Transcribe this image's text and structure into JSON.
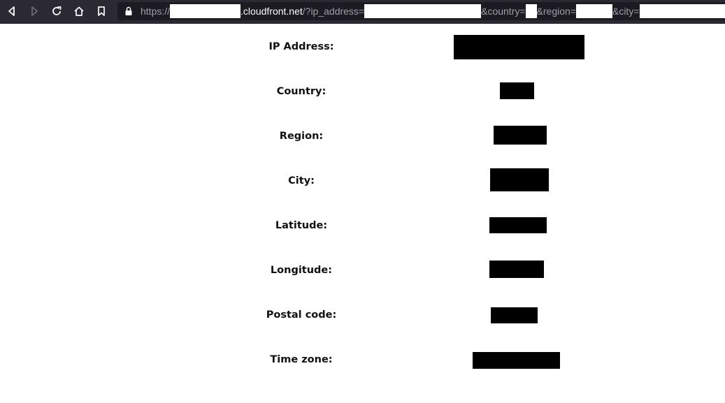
{
  "browser": {
    "url": {
      "scheme": "https://",
      "host": ".cloudfront.net",
      "path": "/?ip_address=",
      "param_country": "&country=",
      "param_region": "&region=",
      "param_city": "&city="
    },
    "icons": {
      "back": "back-arrow-icon",
      "forward": "forward-arrow-icon",
      "reload": "reload-icon",
      "home": "home-icon",
      "bookmark": "bookmark-icon",
      "lock": "lock-icon"
    }
  },
  "fields": [
    {
      "label": "IP Address:"
    },
    {
      "label": "Country:"
    },
    {
      "label": "Region:"
    },
    {
      "label": "City:"
    },
    {
      "label": "Latitude:"
    },
    {
      "label": "Longitude:"
    },
    {
      "label": "Postal code:"
    },
    {
      "label": "Time zone:"
    }
  ]
}
